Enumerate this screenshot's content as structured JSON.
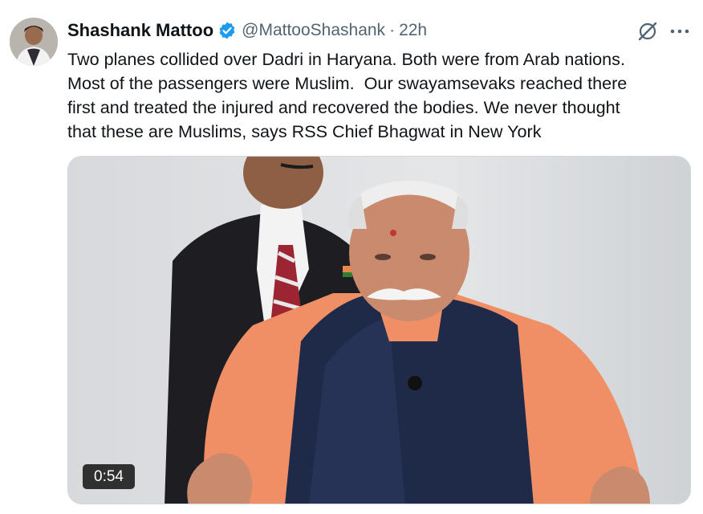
{
  "tweet": {
    "author_name": "Shashank Mattoo",
    "handle": "@MattooShashank",
    "separator": "·",
    "time": "22h",
    "text": "Two planes collided over Dadri in Haryana. Both were from Arab nations.\nMost of the passengers were Muslim.  Our swayamsevaks reached there\nfirst and treated the injured and recovered the bodies. We never thought\nthat these are Muslims, says RSS Chief Bhagwat in New York",
    "video_duration": "0:54"
  },
  "icons": {
    "verified": "verified-badge-icon",
    "grok": "grok-icon",
    "more": "more-options-icon"
  },
  "colors": {
    "verified_blue": "#1d9bf0",
    "text_primary": "#0f1419",
    "text_secondary": "#536471"
  }
}
